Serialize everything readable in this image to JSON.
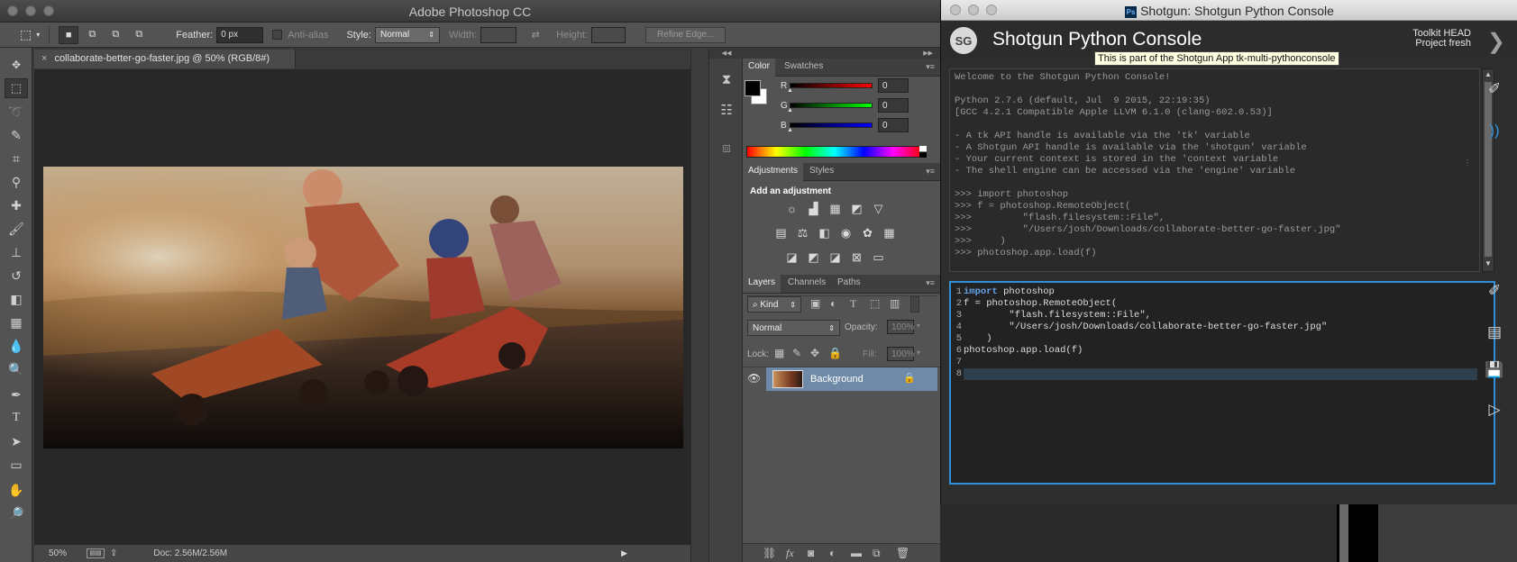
{
  "photoshop": {
    "app_title": "Adobe Photoshop CC",
    "options": {
      "feather_label": "Feather:",
      "feather_value": "0 px",
      "antialias_label": "Anti-alias",
      "style_label": "Style:",
      "style_value": "Normal",
      "width_label": "Width:",
      "height_label": "Height:",
      "refine_edge": "Refine Edge..."
    },
    "document_tab": "collaborate-better-go-faster.jpg @ 50% (RGB/8#)",
    "status": {
      "zoom": "50%",
      "doc": "Doc: 2.56M/2.56M"
    },
    "tools": [
      "move-tool",
      "rectangular-marquee-tool",
      "lasso-tool",
      "quick-selection-tool",
      "crop-tool",
      "eyedropper-tool",
      "spot-healing-tool",
      "brush-tool",
      "clone-stamp-tool",
      "history-brush-tool",
      "eraser-tool",
      "gradient-tool",
      "blur-tool",
      "dodge-tool",
      "pen-tool",
      "type-tool",
      "path-selection-tool",
      "rectangle-tool",
      "hand-tool",
      "zoom-tool"
    ],
    "color_panel": {
      "tabs": [
        "Color",
        "Swatches"
      ],
      "r_label": "R",
      "g_label": "G",
      "b_label": "B",
      "r": "0",
      "g": "0",
      "b": "0",
      "foreground": "#000000",
      "background": "#ffffff"
    },
    "adjustments_panel": {
      "tabs": [
        "Adjustments",
        "Styles"
      ],
      "heading": "Add an adjustment"
    },
    "layers_panel": {
      "tabs": [
        "Layers",
        "Channels",
        "Paths"
      ],
      "filter_kind": "Kind",
      "blend_mode": "Normal",
      "opacity_label": "Opacity:",
      "opacity_value": "100%",
      "lock_label": "Lock:",
      "fill_label": "Fill:",
      "fill_value": "100%",
      "layer_name": "Background"
    }
  },
  "shotgun": {
    "window_title": "Shotgun: Shotgun Python Console",
    "logo_text": "SG",
    "heading": "Shotgun Python Console",
    "toolkit_line1": "Toolkit HEAD",
    "toolkit_line2": "Project fresh",
    "tooltip": "This is part of the Shotgun App tk-multi-pythonconsole",
    "output_lines": [
      "Welcome to the Shotgun Python Console!",
      "",
      "Python 2.7.6 (default, Jul  9 2015, 22:19:35)",
      "[GCC 4.2.1 Compatible Apple LLVM 6.1.0 (clang-602.0.53)]",
      "",
      "- A tk API handle is available via the 'tk' variable",
      "- A Shotgun API handle is available via the 'shotgun' variable",
      "- Your current context is stored in the 'context variable",
      "- The shell engine can be accessed via the 'engine' variable",
      "",
      ">>> import photoshop",
      ">>> f = photoshop.RemoteObject(",
      ">>>         \"flash.filesystem::File\",",
      ">>>         \"/Users/josh/Downloads/collaborate-better-go-faster.jpg\"",
      ">>>     )",
      ">>> photoshop.app.load(f)"
    ],
    "input_gutter": "1\n2\n3\n4\n5\n6\n7\n8",
    "input_keyword": "import",
    "input_line1_rest": " photoshop",
    "input_rest": "f = photoshop.RemoteObject(\n        \"flash.filesystem::File\",\n        \"/Users/josh/Downloads/collaborate-better-go-faster.jpg\"\n    )\nphotoshop.app.load(f)\n\n",
    "accent": "#2f8fd8"
  }
}
